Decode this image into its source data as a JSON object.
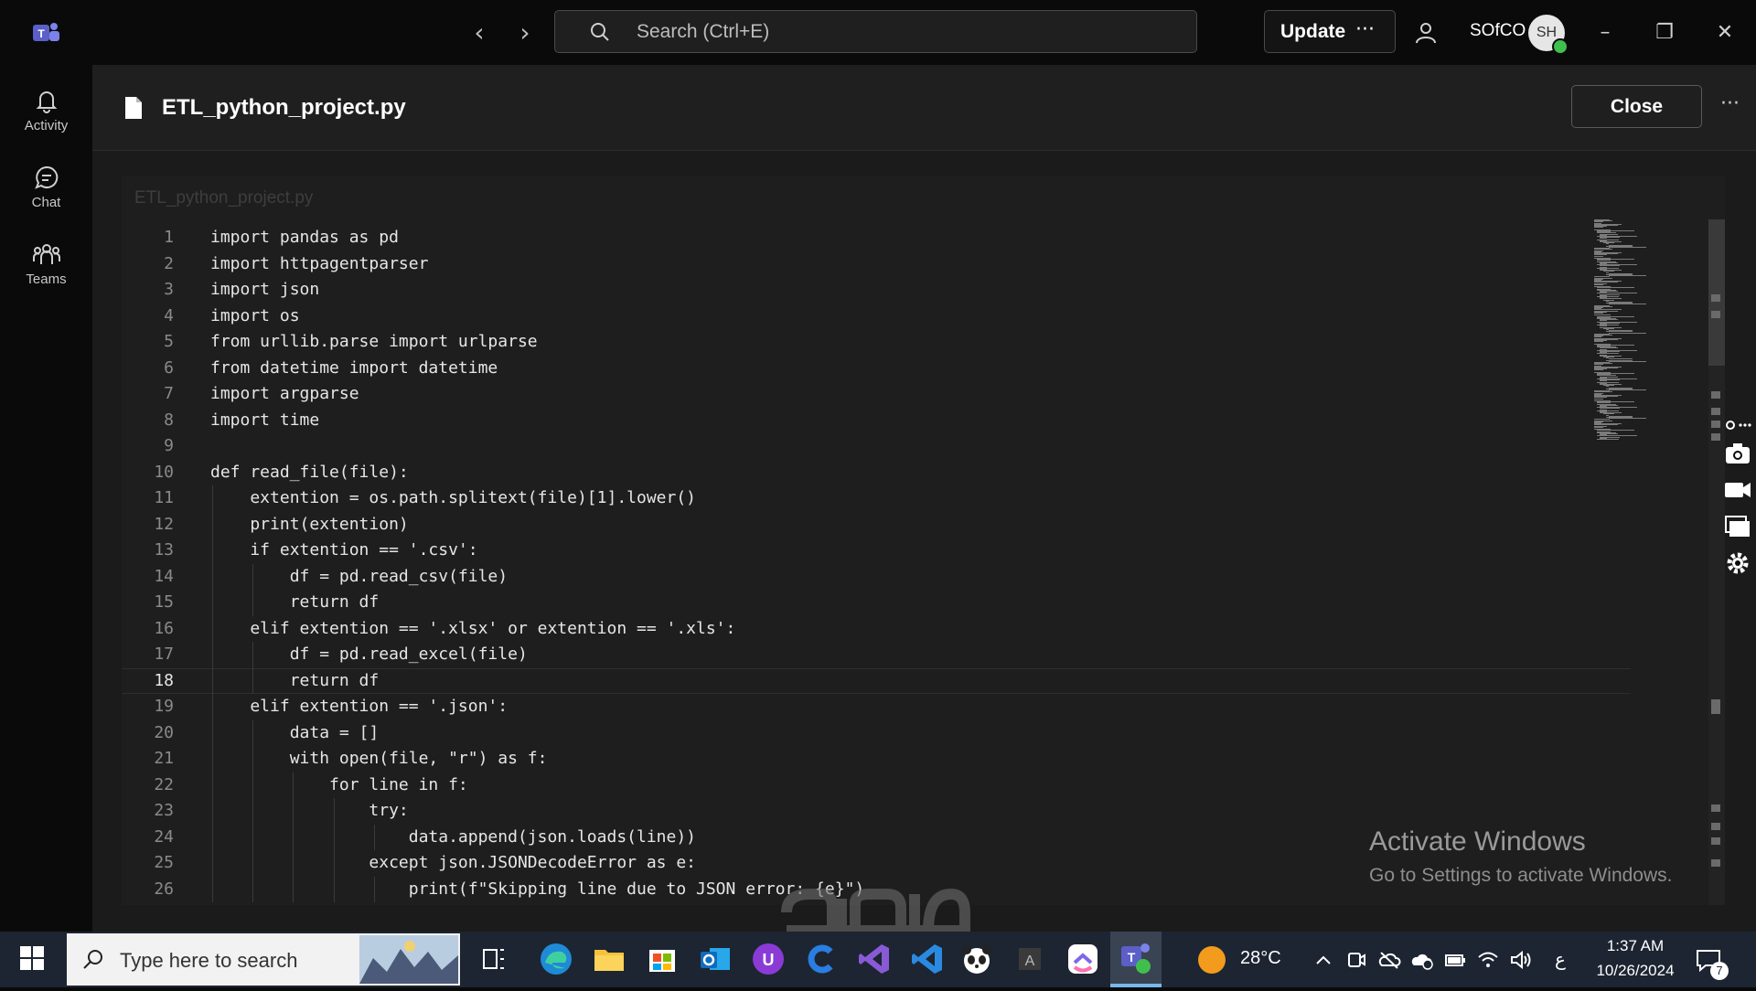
{
  "titlebar": {
    "search_placeholder": "Search (Ctrl+E)",
    "update_label": "Update",
    "more_label": "···",
    "org_name": "SOfCO",
    "avatar_initials": "SH"
  },
  "rail": {
    "items": [
      {
        "label": "Activity",
        "icon": "bell-icon"
      },
      {
        "label": "Chat",
        "icon": "chat-icon"
      },
      {
        "label": "Teams",
        "icon": "teams-icon"
      }
    ]
  },
  "file": {
    "title": "ETL_python_project.py",
    "close_label": "Close",
    "more_label": "···",
    "tab_name": "ETL_python_project.py",
    "current_line": 18,
    "lines": [
      {
        "n": "1",
        "code": "import pandas as pd"
      },
      {
        "n": "2",
        "code": "import httpagentparser"
      },
      {
        "n": "3",
        "code": "import json"
      },
      {
        "n": "4",
        "code": "import os"
      },
      {
        "n": "5",
        "code": "from urllib.parse import urlparse"
      },
      {
        "n": "6",
        "code": "from datetime import datetime"
      },
      {
        "n": "7",
        "code": "import argparse"
      },
      {
        "n": "8",
        "code": "import time"
      },
      {
        "n": "9",
        "code": ""
      },
      {
        "n": "10",
        "code": "def read_file(file):"
      },
      {
        "n": "11",
        "code": "    extention = os.path.splitext(file)[1].lower()"
      },
      {
        "n": "12",
        "code": "    print(extention)"
      },
      {
        "n": "13",
        "code": "    if extention == '.csv':"
      },
      {
        "n": "14",
        "code": "        df = pd.read_csv(file)"
      },
      {
        "n": "15",
        "code": "        return df"
      },
      {
        "n": "16",
        "code": "    elif extention == '.xlsx' or extention == '.xls':"
      },
      {
        "n": "17",
        "code": "        df = pd.read_excel(file)"
      },
      {
        "n": "18",
        "code": "        return df"
      },
      {
        "n": "19",
        "code": "    elif extention == '.json':"
      },
      {
        "n": "20",
        "code": "        data = []"
      },
      {
        "n": "21",
        "code": "        with open(file, \"r\") as f:"
      },
      {
        "n": "22",
        "code": "            for line in f:"
      },
      {
        "n": "23",
        "code": "                try:"
      },
      {
        "n": "24",
        "code": "                    data.append(json.loads(line))"
      },
      {
        "n": "25",
        "code": "                except json.JSONDecodeError as e:"
      },
      {
        "n": "26",
        "code": "                    print(f\"Skipping line due to JSON error: {e}\")"
      }
    ]
  },
  "watermark": {
    "title": "Activate Windows",
    "subtitle": "Go to Settings to activate Windows."
  },
  "taskbar": {
    "search_placeholder": "Type here to search",
    "temperature": "28°C",
    "language": "ع",
    "time": "1:37 AM",
    "date": "10/26/2024",
    "notification_count": "7",
    "apps": [
      "task-view",
      "edge",
      "file-explorer",
      "store",
      "outlook",
      "u-app",
      "c-app",
      "visual-studio",
      "vscode",
      "panda-app",
      "a-app",
      "clickup",
      "teams"
    ]
  },
  "colors": {
    "accent": "#5b5fc7",
    "status_green": "#3fbf4e",
    "taskbar": "#1d2532"
  }
}
